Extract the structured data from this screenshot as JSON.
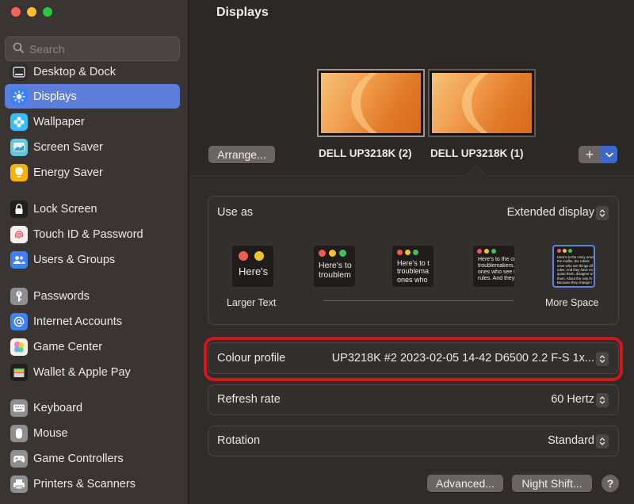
{
  "window": {
    "traffic_colors": [
      "#fe5f57",
      "#febc2e",
      "#28c840"
    ]
  },
  "sidebar": {
    "search_placeholder": "Search",
    "items": [
      {
        "label": "Desktop & Dock",
        "icon": "desktop-dock-icon",
        "color": "#2c2c2e",
        "selected": false
      },
      {
        "label": "Displays",
        "icon": "sun-icon",
        "color": "#3b82f6",
        "selected": true
      },
      {
        "label": "Wallpaper",
        "icon": "flower-icon",
        "color": "#38bdf8",
        "selected": false
      },
      {
        "label": "Screen Saver",
        "icon": "screen-saver-icon",
        "color": "#60c8e0",
        "selected": false
      },
      {
        "label": "Energy Saver",
        "icon": "lightbulb-icon",
        "color": "#f5b400",
        "selected": false
      },
      {
        "label": "Lock Screen",
        "icon": "lock-icon",
        "color": "#1f1f1f",
        "selected": false
      },
      {
        "label": "Touch ID & Password",
        "icon": "fingerprint-icon",
        "color": "#f3f0ee",
        "selected": false
      },
      {
        "label": "Users & Groups",
        "icon": "users-icon",
        "color": "#3b82f6",
        "selected": false
      },
      {
        "label": "Passwords",
        "icon": "key-icon",
        "color": "#8e8e93",
        "selected": false
      },
      {
        "label": "Internet Accounts",
        "icon": "at-icon",
        "color": "#3b82f6",
        "selected": false
      },
      {
        "label": "Game Center",
        "icon": "game-center-icon",
        "color": "#f3f0ee",
        "selected": false
      },
      {
        "label": "Wallet & Apple Pay",
        "icon": "wallet-icon",
        "color": "#1f1f1f",
        "selected": false
      },
      {
        "label": "Keyboard",
        "icon": "keyboard-icon",
        "color": "#8e8e93",
        "selected": false
      },
      {
        "label": "Mouse",
        "icon": "mouse-icon",
        "color": "#8e8e93",
        "selected": false
      },
      {
        "label": "Game Controllers",
        "icon": "game-controller-icon",
        "color": "#8e8e93",
        "selected": false
      },
      {
        "label": "Printers & Scanners",
        "icon": "printer-icon",
        "color": "#8e8e93",
        "selected": false
      }
    ]
  },
  "main": {
    "title": "Displays",
    "arrange_label": "Arrange...",
    "displays": [
      {
        "name": "DELL UP3218K (2)",
        "selected": false
      },
      {
        "name": "DELL UP3218K (1)",
        "selected": true
      }
    ],
    "add_label": "+",
    "use_as": {
      "label": "Use as",
      "value": "Extended display",
      "resolutions": [
        {
          "sample": "Here's",
          "label": "Larger Text"
        },
        {
          "sample": "Here's to\ntroublem",
          "label": ""
        },
        {
          "sample": "Here's to t\ntroublema\nones who",
          "label": ""
        },
        {
          "sample": "Here's to the cr\ntroublemakers.\nones who see t\nrules. And they",
          "label": ""
        },
        {
          "sample": "Here's to the crazy ones\nthe misfits, the rebels\nones who see things dif\nrules. And they have no\nquote them, disagree w\nthem. About the only th\nBecause they change t\nHere's to the crazy on",
          "label": "More Space"
        }
      ]
    },
    "colour_profile": {
      "label": "Colour profile",
      "value": "UP3218K #2 2023-02-05 14-42 D6500 2.2 F-S 1x..."
    },
    "refresh_rate": {
      "label": "Refresh rate",
      "value": "60 Hertz"
    },
    "rotation": {
      "label": "Rotation",
      "value": "Standard"
    },
    "advanced_label": "Advanced...",
    "night_shift_label": "Night Shift...",
    "help_label": "?",
    "highlight_color": "#d7141a"
  }
}
